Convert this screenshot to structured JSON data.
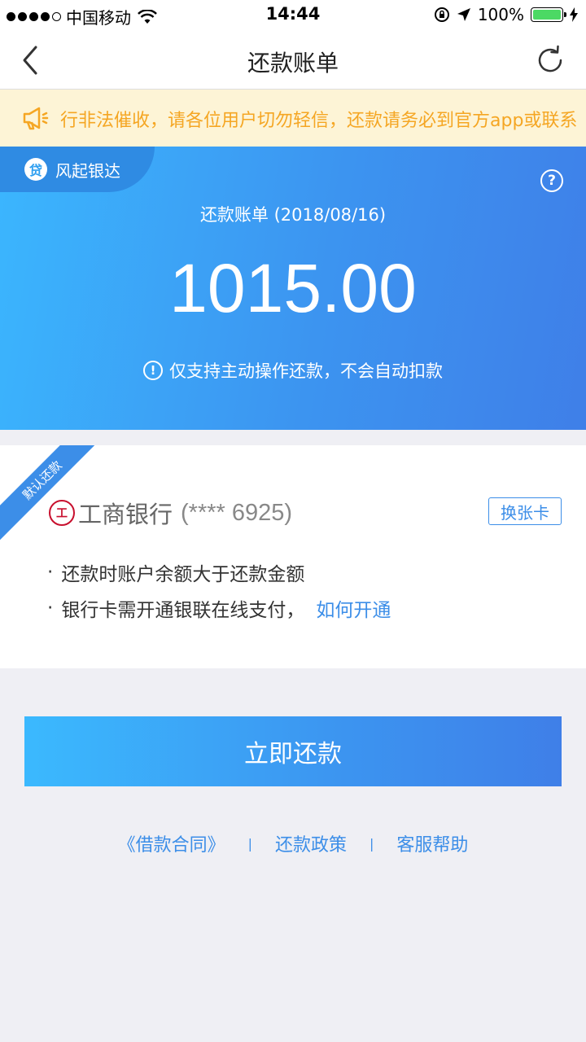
{
  "status_bar": {
    "carrier": "中国移动",
    "time": "14:44",
    "battery": "100%"
  },
  "nav": {
    "title": "还款账单"
  },
  "notice": {
    "text": "行非法催收，请各位用户切勿轻信，还款请务必到官方app或联系"
  },
  "hero": {
    "product_icon_char": "贷",
    "product_name": "风起银达",
    "help": "?",
    "bill_title": "还款账单 (2018/08/16)",
    "amount": "1015.00",
    "note_icon": "!",
    "note": "仅支持主动操作还款，不会自动扣款"
  },
  "card": {
    "ribbon": "默认还款",
    "bank_logo_char": "工",
    "bank_name": "工商银行",
    "card_number": "(**** 6925)",
    "change_card": "换张卡",
    "tips": [
      {
        "bullet": "·",
        "text": "还款时账户余额大于还款金额"
      },
      {
        "bullet": "·",
        "text": "银行卡需开通银联在线支付，",
        "link": "如何开通"
      }
    ]
  },
  "repay_button": "立即还款",
  "footer": {
    "links": [
      "《借款合同》",
      "还款政策",
      "客服帮助"
    ],
    "separator": "|"
  },
  "colors": {
    "accent": "#3c8ee8",
    "notice_text": "#f5a623",
    "notice_bg": "#fdf4d6",
    "page_bg": "#efeff4"
  }
}
